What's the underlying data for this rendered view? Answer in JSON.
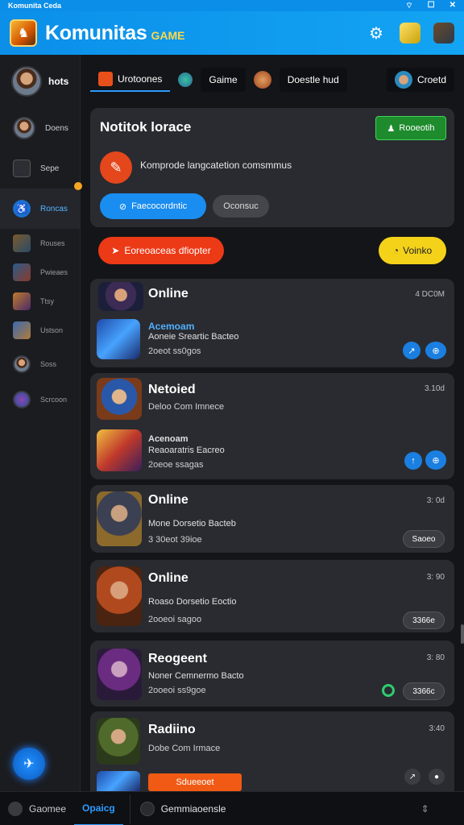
{
  "statusbar": {
    "title": "Komunita Ceda"
  },
  "header": {
    "title": "Komunitas",
    "subtitle": "GAME"
  },
  "sidebar": {
    "profile_name": "hots",
    "items": [
      {
        "label": "Doens"
      },
      {
        "label": "Sepe"
      },
      {
        "label": "Roncas"
      },
      {
        "label": "Rouses"
      },
      {
        "label": "Pwieaes"
      },
      {
        "label": "Ttsy"
      },
      {
        "label": "Ustson"
      },
      {
        "label": "Soss"
      },
      {
        "label": "Scrcoon"
      }
    ]
  },
  "tabs": [
    {
      "label": "Urotoones"
    },
    {
      "label": "Gaime"
    },
    {
      "label": "Doestle hud"
    },
    {
      "label": "Croetd"
    }
  ],
  "notice": {
    "title": "Notitok lorace",
    "button": "Rooeotih",
    "text": "Komprode langcatetion comsmmus",
    "primary_button": "Faecocordntic",
    "secondary_button": "Oconsuc"
  },
  "actions": {
    "red_button": "Eoreoaceas dfiopter",
    "yellow_button": "Voinko"
  },
  "feed": [
    {
      "title": "Online",
      "time": "4 DC0M",
      "sub": "Acemoam",
      "line": "Aoneie Sreartic Bacteo",
      "meta": "2oeot ss0gos"
    },
    {
      "title": "Netoied",
      "time": "3.10d",
      "line": "Deloo Com Imnece",
      "sub": "Acenoam",
      "line2": "Reaoaratris Eacreo",
      "meta": "2oeoe ssagas"
    },
    {
      "title": "Online",
      "time": "3: 0d",
      "line": "Mone Dorsetio Bacteb",
      "meta": "3 30eot 39ioe",
      "button": "Saoeo"
    },
    {
      "title": "Online",
      "time": "3: 90",
      "line": "Roaso Dorsetio Eoctio",
      "meta": "2ooeoi sagoo",
      "button": "3366e"
    },
    {
      "title": "Reogeent",
      "time": "3: 80",
      "line": "Noner Cemnermo Bacto",
      "meta": "2ooeoi ss9goe",
      "button": "3366c"
    },
    {
      "title": "Radiino",
      "time": "3:40",
      "line": "Dobe Com Irmace",
      "orange_button": "Sdueeoet"
    }
  ],
  "bottombar": {
    "left": "Gaomee",
    "active": "Opaicg",
    "input": "Gemmiaoensle"
  }
}
